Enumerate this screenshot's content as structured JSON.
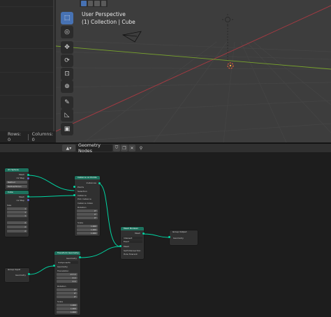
{
  "viewport": {
    "perspective_label": "User Perspective",
    "collection_label": "(1) Collection | Cube"
  },
  "spreadsheet": {
    "rows_label": "Rows: 0",
    "columns_label": "Columns: 0"
  },
  "node_editor": {
    "tree_name": "Geometry Nodes",
    "editor_icon": "geometry-nodes-icon"
  },
  "nodes": {
    "uv_sphere": {
      "title": "UV Sphere",
      "mesh": "Mesh",
      "uv_map": "UV Map",
      "method_label": "Method",
      "method_value": "B-S...",
      "radius_label": "Radius/Dimen",
      "radius_value": ""
    },
    "cube": {
      "title": "Cube",
      "mesh": "Mesh",
      "uv_map": "UV Map",
      "size_label": "Size",
      "size_x": "1",
      "size_y": "1",
      "size_z": "1",
      "vx_label": "Vertices X",
      "vx": "2",
      "vy_label": "Vertices Y",
      "vy": "2",
      "vz_label": "Vertices Z",
      "vz": "2"
    },
    "instance_on_points": {
      "title": "Instance on Points",
      "out": "Instances",
      "points": "Points",
      "selection": "Selection",
      "instance": "Instance",
      "pick": "Pick Instance",
      "instance_index": "Instance Index",
      "rotation": "Rotation",
      "rx": "0°",
      "ry": "0°",
      "rz": "0°",
      "scale": "Scale",
      "sx": "1.000",
      "sy": "1.000",
      "sz": "1.000"
    },
    "mesh_boolean": {
      "title": "Mesh Boolean",
      "mesh_out": "Mesh",
      "mode": "Intersect",
      "solver": "Exact",
      "mesh_in": "Mesh",
      "self_intersection": "Self Intersection",
      "hole_tolerant": "Hole Tolerant"
    },
    "group_output": {
      "title": "Group Output",
      "geometry": "Geometry"
    },
    "group_input": {
      "title": "Group Input",
      "geometry": "Geometry"
    },
    "transform": {
      "title": "Transform Geometry",
      "geometry_out": "Geometry",
      "mode": "Components",
      "geometry_in": "Geometry",
      "translation": "Translation",
      "tx": "-0.3 m",
      "ty": "0 m",
      "tz": "0 m",
      "rotation": "Rotation",
      "rx": "0°",
      "ry": "0°",
      "rz": "0°",
      "scale": "Scale",
      "sx": "1.000",
      "sy": "1.000",
      "sz": "1.000"
    }
  },
  "colors": {
    "geometry_header": "#1d725e",
    "grid_line": "#454545",
    "x_axis": "#a33a42",
    "y_axis": "#79a42c",
    "accent": "#4772b3"
  }
}
